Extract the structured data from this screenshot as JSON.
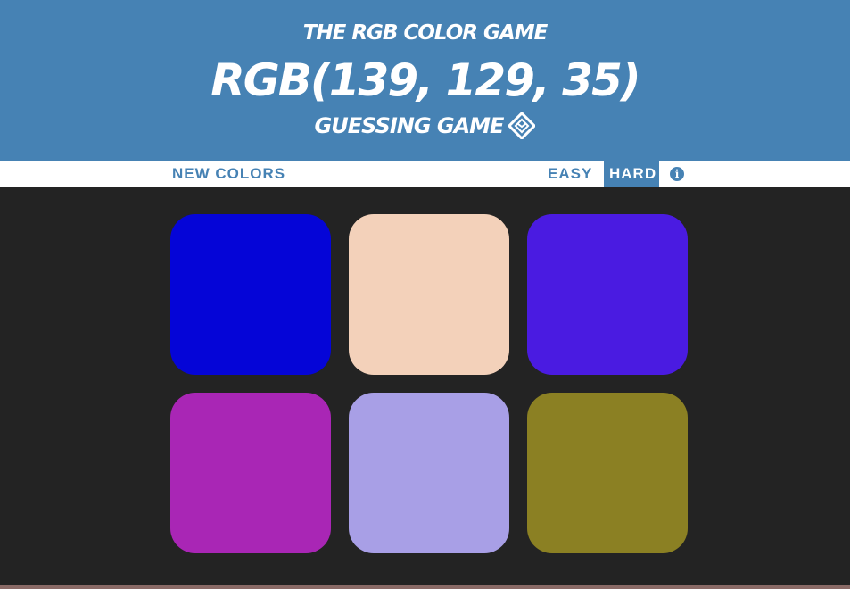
{
  "header": {
    "subtitle_top": "THE RGB COLOR GAME",
    "rgb_target": "RGB(139, 129, 35)",
    "subtitle_bottom": "GUESSING GAME",
    "icon": "dice-icon"
  },
  "stripe": {
    "new_colors_label": "NEW COLORS",
    "easy_label": "EASY",
    "hard_label": "HARD",
    "info_label": "i",
    "selected_mode": "HARD"
  },
  "colors": {
    "header_bg": "#4682b4",
    "body_bg": "#232323",
    "stripe_bg": "#ffffff"
  },
  "squares": [
    {
      "color": "#0505d7"
    },
    {
      "color": "#f3d1ba"
    },
    {
      "color": "#4a1be1"
    },
    {
      "color": "#a926b5"
    },
    {
      "color": "#a89fe6"
    },
    {
      "color": "#8b8023"
    }
  ]
}
